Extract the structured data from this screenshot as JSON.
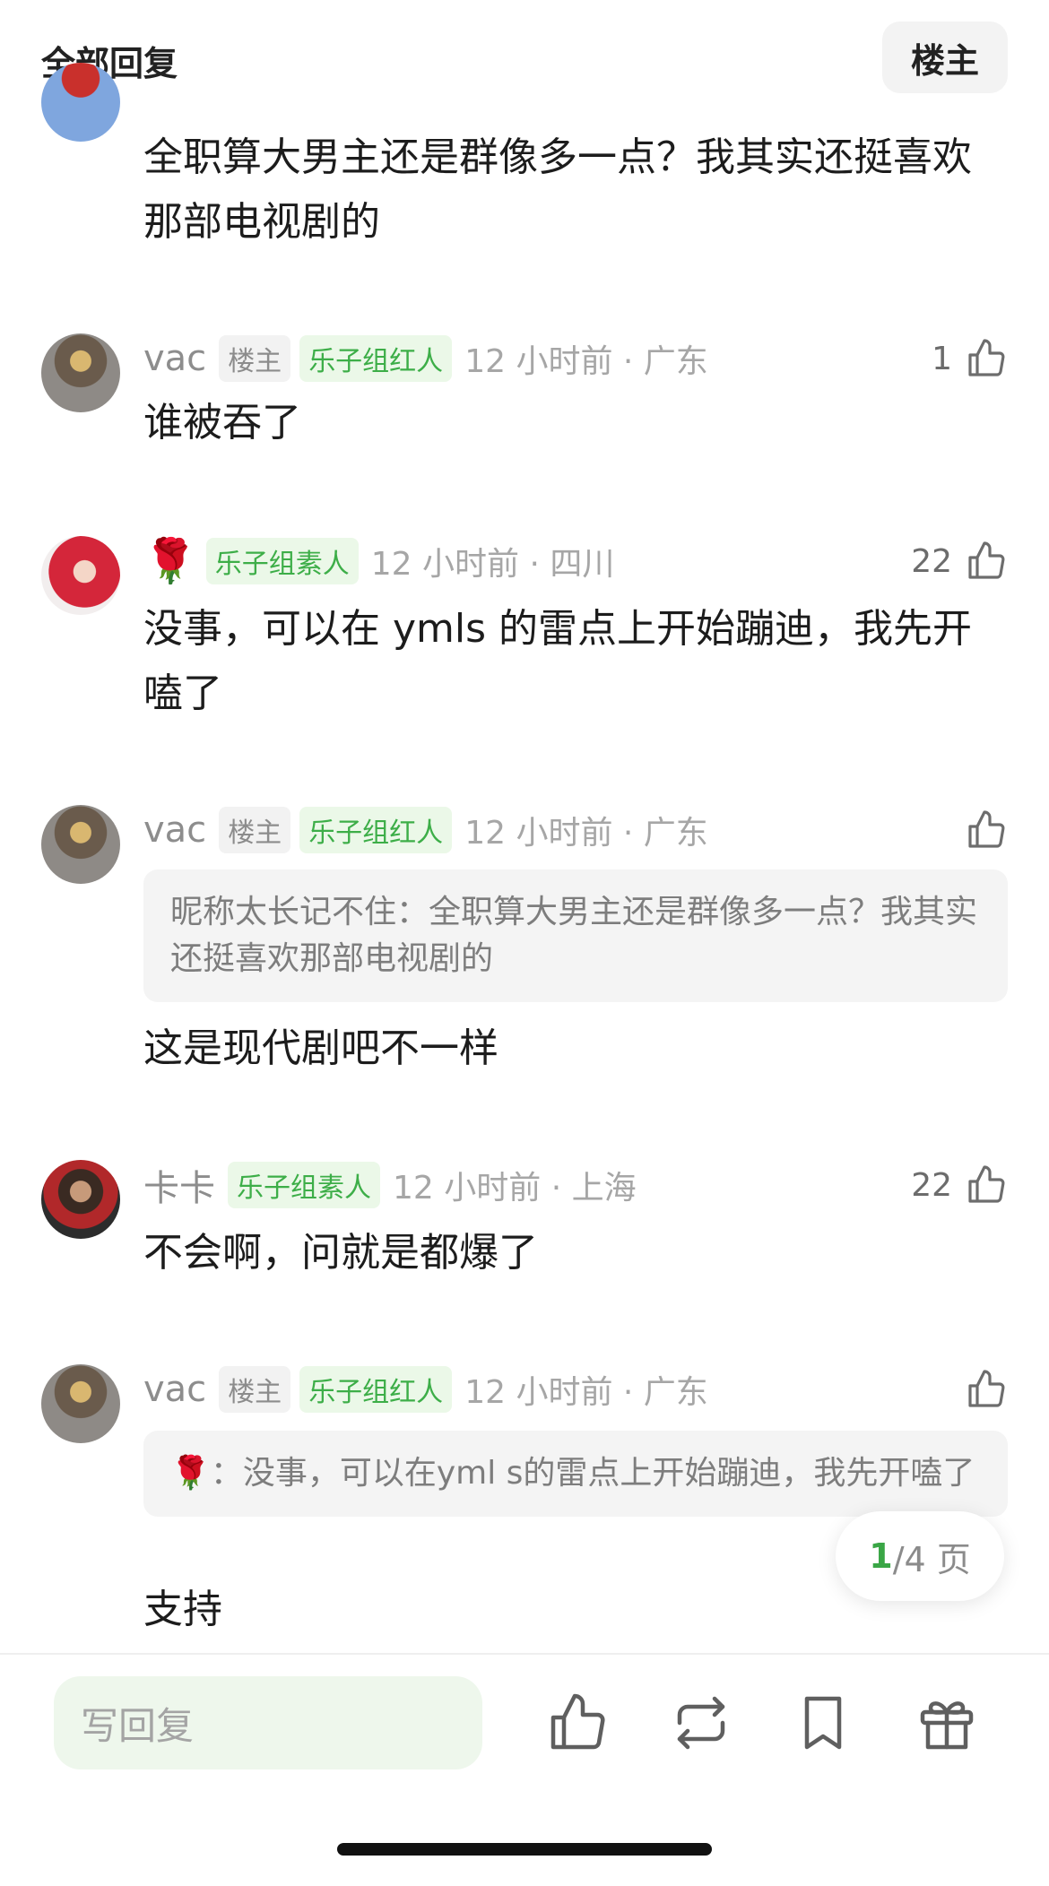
{
  "header": {
    "title": "全部回复",
    "owner_filter": "楼主"
  },
  "comments": [
    {
      "content": "全职算大男主还是群像多一点？我其实还挺喜欢那部电视剧的"
    },
    {
      "username": "vac",
      "owner_tag": "楼主",
      "badge": "乐子组红人",
      "time": "12 小时前 · 广东",
      "likes": "1",
      "content": "谁被吞了"
    },
    {
      "username_icon": "🌹",
      "badge": "乐子组素人",
      "time": "12 小时前 · 四川",
      "likes": "22",
      "content": "没事，可以在 ymls 的雷点上开始蹦迪，我先开嗑了"
    },
    {
      "username": "vac",
      "owner_tag": "楼主",
      "badge": "乐子组红人",
      "time": "12 小时前 · 广东",
      "likes": "",
      "quote": "昵称太长记不住：全职算大男主还是群像多一点？我其实还挺喜欢那部电视剧的",
      "content": "这是现代剧吧不一样"
    },
    {
      "username": "卡卡",
      "badge": "乐子组素人",
      "time": "12 小时前 · 上海",
      "likes": "22",
      "content": "不会啊，问就是都爆了"
    },
    {
      "username": "vac",
      "owner_tag": "楼主",
      "badge": "乐子组红人",
      "time": "12 小时前 · 广东",
      "likes": "",
      "quote_icon": "🌹",
      "quote": "：没事，可以在yml s的雷点上开始蹦迪，我先开嗑了",
      "content": "支持"
    }
  ],
  "pager": {
    "current": "1",
    "total": "/4 页"
  },
  "bottom_bar": {
    "reply_placeholder": "写回复",
    "icons": [
      "like-icon",
      "repost-icon",
      "bookmark-icon",
      "gift-icon"
    ]
  },
  "colors": {
    "accent_green": "#3dae48",
    "badge_bg": "#ebf8e8",
    "input_bg": "#eef7ec"
  }
}
